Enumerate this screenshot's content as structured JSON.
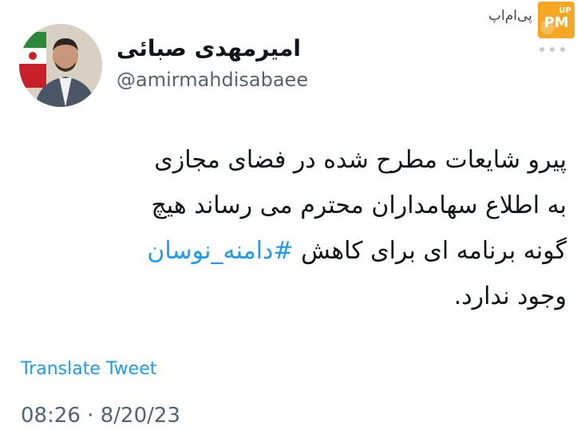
{
  "author": {
    "display_name": "امیرمهدی صبائی",
    "handle": "@amirmahdisabaee",
    "avatar_icon": "profile-photo"
  },
  "menu": {
    "icon": "more-dots-icon"
  },
  "watermark": {
    "text": "پی‌ام‌اپ",
    "badge": "PM"
  },
  "tweet": {
    "lines": [
      "پیرو شایعات مطرح شده در فضای مجازی",
      "به اطلاع سهامداران محترم می رساند هیچ",
      "گونه برنامه ای برای کاهش ",
      "وجود ندارد."
    ],
    "hashtag": "#دامنه_نوسان",
    "translate_label": "Translate Tweet",
    "timestamp": "08:26 · 8/20/23"
  },
  "colors": {
    "link": "#1d9bf0",
    "text": "#0f1419",
    "muted": "#536471",
    "watermark_orange": "#f5a623"
  }
}
